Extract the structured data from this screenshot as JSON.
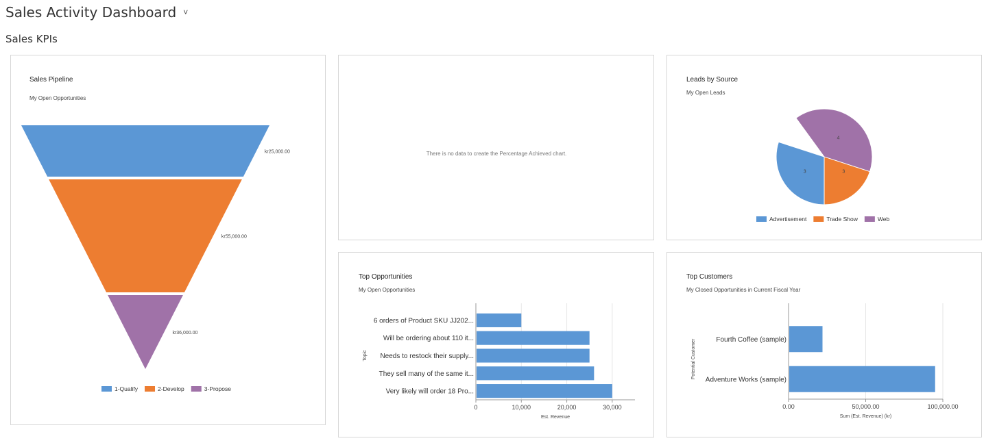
{
  "header": {
    "title": "Sales Activity Dashboard",
    "chevron_icon": "chevron-down-icon"
  },
  "section": {
    "title": "Sales KPIs"
  },
  "colors": {
    "blue": "#5b97d5",
    "orange": "#ed7d31",
    "purple": "#a072a8"
  },
  "panels": {
    "pipeline": {
      "title": "Sales Pipeline",
      "subtitle": "My Open Opportunities"
    },
    "percentage": {
      "message": "There is no data to create the Percentage Achieved chart."
    },
    "leads": {
      "title": "Leads by Source",
      "subtitle": "My Open Leads"
    },
    "top_opps": {
      "title": "Top Opportunities",
      "subtitle": "My Open Opportunities"
    },
    "top_customers": {
      "title": "Top Customers",
      "subtitle": "My Closed Opportunities in Current Fiscal Year"
    }
  },
  "chart_data": [
    {
      "id": "pipeline",
      "type": "funnel",
      "categories": [
        "1-Qualify",
        "2-Develop",
        "3-Propose"
      ],
      "values": [
        25000,
        55000,
        36000
      ],
      "value_labels": [
        "kr25,000.00",
        "kr55,000.00",
        "kr36,000.00"
      ],
      "legend": [
        "1-Qualify",
        "2-Develop",
        "3-Propose"
      ],
      "legend_position": "bottom"
    },
    {
      "id": "leads",
      "type": "pie",
      "categories": [
        "Advertisement",
        "Trade Show",
        "Web"
      ],
      "values": [
        3,
        3,
        4
      ],
      "legend": [
        "Advertisement",
        "Trade Show",
        "Web"
      ],
      "legend_position": "bottom"
    },
    {
      "id": "top_opps",
      "type": "bar",
      "orientation": "horizontal",
      "categories": [
        "6 orders of Product SKU JJ202...",
        "Will be ordering about 110 it...",
        "Needs to restock their supply...",
        "They sell many of the same it...",
        "Very likely will order 18 Pro..."
      ],
      "values": [
        10000,
        25000,
        25000,
        26000,
        30000
      ],
      "xlabel": "Est. Revenue",
      "ylabel": "Topic",
      "xlim": [
        0,
        35000
      ],
      "xticks": [
        "0",
        "10,000",
        "20,000",
        "30,000"
      ],
      "grid": true
    },
    {
      "id": "top_customers",
      "type": "bar",
      "orientation": "horizontal",
      "categories": [
        "Fourth Coffee (sample)",
        "Adventure Works (sample)"
      ],
      "values": [
        22000,
        95000
      ],
      "xlabel": "Sum (Est. Revenue) (kr)",
      "ylabel": "Potential Customer",
      "xlim": [
        0,
        100000
      ],
      "xticks": [
        "0.00",
        "50,000.00",
        "100,000.00"
      ],
      "grid": true
    }
  ]
}
